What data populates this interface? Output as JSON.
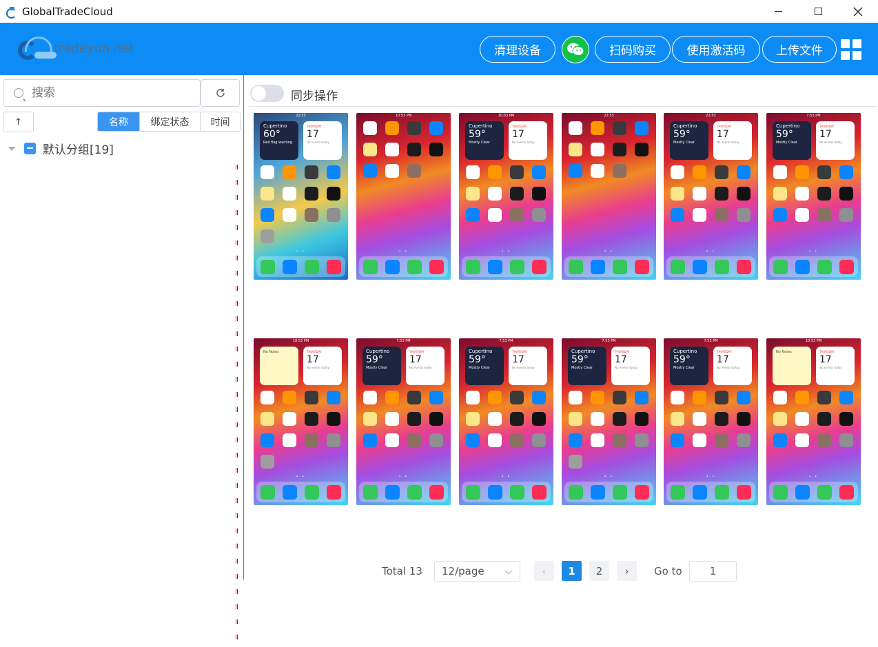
{
  "window": {
    "title": "GlobalTradeCloud"
  },
  "header": {
    "logo_text": "tradeyun.net",
    "clean_label": "清理设备",
    "scan_label": "扫码购买",
    "activate_label": "使用激活码",
    "upload_label": "上传文件"
  },
  "sidebar": {
    "search_placeholder": "搜索",
    "sort_up": "↑",
    "sort_tabs": [
      "名称",
      "绑定状态",
      "时间"
    ],
    "group_label": "默认分组[19]"
  },
  "main": {
    "sync_label": "同步操作",
    "phones": [
      {
        "time": "22:53",
        "theme": "blue",
        "weather_temp": "60°",
        "city": "Cupertino",
        "weather_note": "Red flag warning",
        "cal_day": "17",
        "cal_weekday": "THURSDAY",
        "cal_note": "No events today"
      },
      {
        "time": "10:53 PM",
        "theme": "red",
        "weather_temp": "",
        "city": "",
        "weather_note": "",
        "cal_day": "",
        "cal_weekday": "",
        "cal_note": ""
      },
      {
        "time": "10:53 PM",
        "theme": "red",
        "weather_temp": "59°",
        "city": "Cupertino",
        "weather_note": "Mostly Clear",
        "cal_day": "17",
        "cal_weekday": "THURSDAY",
        "cal_note": "No events today"
      },
      {
        "time": "22:53",
        "theme": "red",
        "weather_temp": "",
        "city": "",
        "weather_note": "",
        "cal_day": "",
        "cal_weekday": "",
        "cal_note": ""
      },
      {
        "time": "22:53",
        "theme": "red",
        "weather_temp": "59°",
        "city": "Cupertino",
        "weather_note": "Mostly Clear",
        "cal_day": "17",
        "cal_weekday": "THURSDAY",
        "cal_note": "No events today"
      },
      {
        "time": "7:53 PM",
        "theme": "red",
        "weather_temp": "59°",
        "city": "Cupertino",
        "weather_note": "Mostly Clear",
        "cal_day": "17",
        "cal_weekday": "THURSDAY",
        "cal_note": "No events today"
      },
      {
        "time": "10:53 PM",
        "theme": "red",
        "weather_temp": "",
        "city": "",
        "weather_note": "No Notes",
        "cal_day": "17",
        "cal_weekday": "THURSDAY",
        "cal_note": "No events today"
      },
      {
        "time": "7:53 PM",
        "theme": "red",
        "weather_temp": "59°",
        "city": "Cupertino",
        "weather_note": "Mostly Clear",
        "cal_day": "17",
        "cal_weekday": "THURSDAY",
        "cal_note": "No events today"
      },
      {
        "time": "7:53 PM",
        "theme": "red",
        "weather_temp": "59°",
        "city": "Cupertino",
        "weather_note": "Mostly Clear",
        "cal_day": "17",
        "cal_weekday": "THURSDAY",
        "cal_note": "No events today"
      },
      {
        "time": "7:53 PM",
        "theme": "red",
        "weather_temp": "59°",
        "city": "Cupertino",
        "weather_note": "Mostly Clear",
        "cal_day": "17",
        "cal_weekday": "THURSDAY",
        "cal_note": "No events today"
      },
      {
        "time": "7:53 PM",
        "theme": "red",
        "weather_temp": "59°",
        "city": "Cupertino",
        "weather_note": "Mostly Clear",
        "cal_day": "17",
        "cal_weekday": "THURSDAY",
        "cal_note": "No events today"
      },
      {
        "time": "10:53 PM",
        "theme": "red",
        "weather_temp": "",
        "city": "",
        "weather_note": "No Notes",
        "cal_day": "17",
        "cal_weekday": "THURSDAY",
        "cal_note": "No events today"
      }
    ]
  },
  "pagination": {
    "total": "Total 13",
    "page_size": "12/page",
    "pages": [
      "1",
      "2"
    ],
    "goto_label": "Go to",
    "goto_value": "1"
  },
  "colors": {
    "header_bg": "#0d8cf6",
    "accent": "#3a95f0",
    "wechat": "#11c14a"
  }
}
